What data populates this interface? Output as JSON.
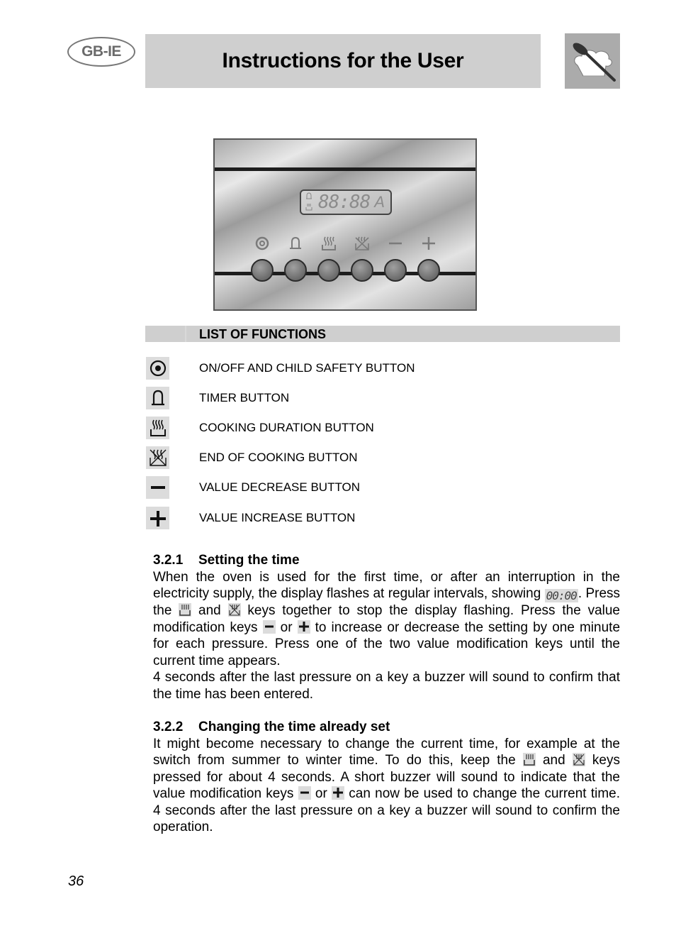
{
  "header": {
    "region_badge": "GB-IE",
    "title": "Instructions for the User",
    "logo_icon": "chef-hat-spoon-icon"
  },
  "control_panel": {
    "display_digits": "88:88",
    "display_mode": "A",
    "display_indicators": [
      "bell-icon",
      "cooking-pot-icon"
    ],
    "buttons": [
      {
        "icon": "on-off-icon",
        "glyph": "◎"
      },
      {
        "icon": "bell-icon",
        "glyph": "bell"
      },
      {
        "icon": "cooking-duration-icon",
        "glyph": "pot"
      },
      {
        "icon": "end-of-cooking-icon",
        "glyph": "pot-cross"
      },
      {
        "icon": "minus-icon",
        "glyph": "−"
      },
      {
        "icon": "plus-icon",
        "glyph": "+"
      }
    ]
  },
  "functions": {
    "heading": "LIST OF FUNCTIONS",
    "items": [
      {
        "icon": "on-off-icon",
        "label": "ON/OFF AND CHILD SAFETY BUTTON"
      },
      {
        "icon": "bell-icon",
        "label": "TIMER BUTTON"
      },
      {
        "icon": "cooking-duration-icon",
        "label": "COOKING DURATION BUTTON"
      },
      {
        "icon": "end-of-cooking-icon",
        "label": "END OF COOKING BUTTON"
      },
      {
        "icon": "minus-icon",
        "label": "VALUE DECREASE BUTTON"
      },
      {
        "icon": "plus-icon",
        "label": "VALUE INCREASE BUTTON"
      }
    ]
  },
  "sections": [
    {
      "number": "3.2.1",
      "title": "Setting the time",
      "p1_a": "When the oven is used for the first time, or after an interruption in the electricity supply, the display flashes at regular intervals, showing ",
      "p1_time": "00:00",
      "p1_b": ". Press the ",
      "p1_c": " and ",
      "p1_d": " keys together to stop the display flashing. Press the value modification keys ",
      "p1_e": " or ",
      "p1_f": " to increase or decrease the setting by one minute for each pressure. Press one of the two value modification keys until the current time appears.",
      "p2": "4 seconds after the last pressure on a key a buzzer will sound to confirm that the time has been entered."
    },
    {
      "number": "3.2.2",
      "title": "Changing the time already set",
      "p1_a": "It might become necessary to change the current time, for example at the switch from summer to winter time. To do this, keep the ",
      "p1_b": " and ",
      "p1_c": " keys pressed for about 4 seconds. A short buzzer will sound to indicate that the value modification keys ",
      "p1_d": " or ",
      "p1_e": " can now be used to change the current time. 4 seconds after the last pressure on a key a buzzer will sound to confirm the operation."
    }
  ],
  "footer": {
    "page_number": "36"
  }
}
